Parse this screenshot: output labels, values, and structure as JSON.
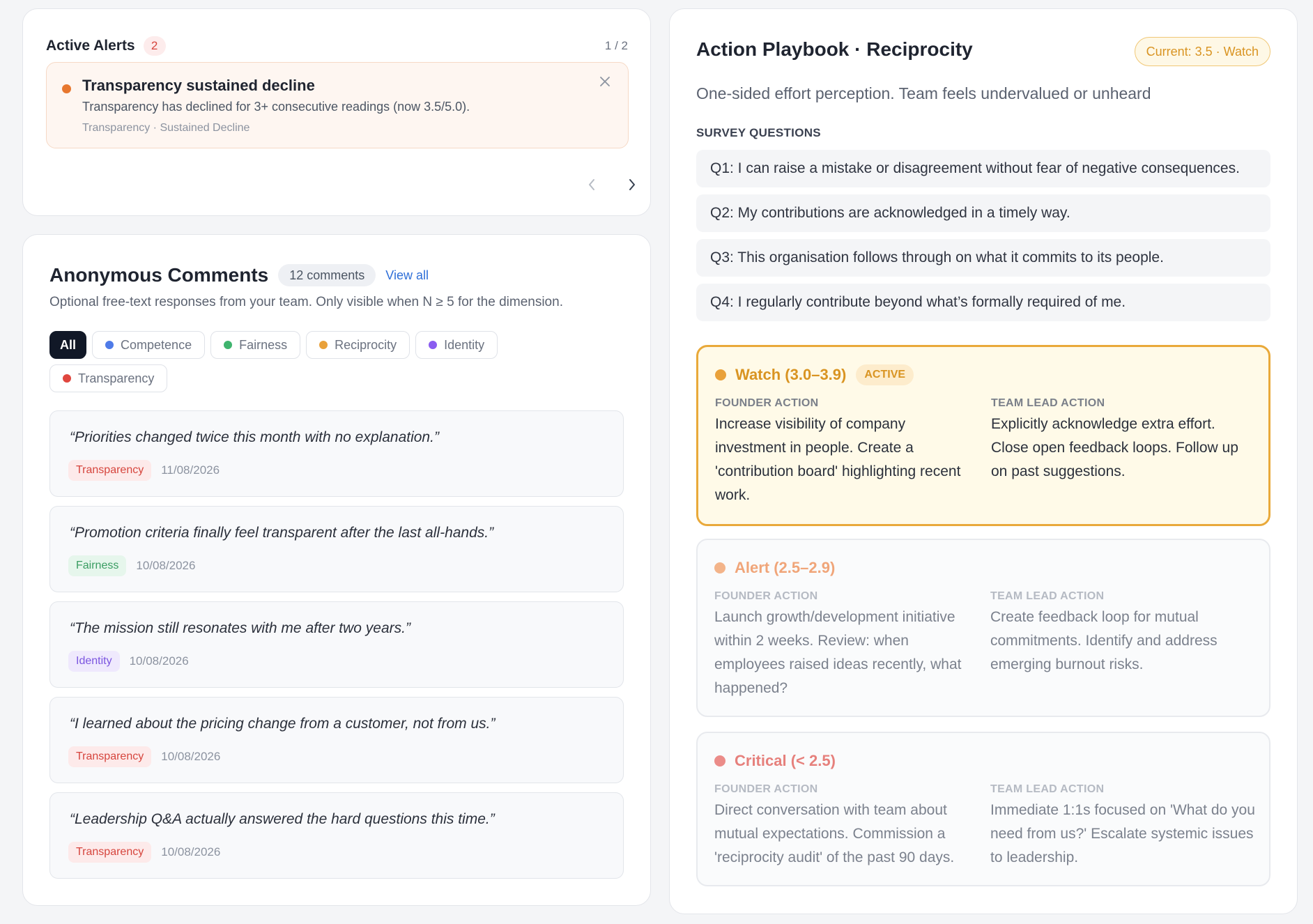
{
  "alerts": {
    "title": "Active Alerts",
    "count": "2",
    "pager": "1 / 2",
    "current": {
      "title": "Transparency sustained decline",
      "description": "Transparency has declined for 3+ consecutive readings (now 3.5/5.0).",
      "meta": "Transparency · Sustained Decline",
      "dot_color": "#e7772f"
    }
  },
  "comments": {
    "title": "Anonymous Comments",
    "count_label": "12 comments",
    "view_all": "View all",
    "subtitle": "Optional free-text responses from your team. Only visible when N ≥ 5 for the dimension.",
    "filters": [
      {
        "label": "All",
        "active": true
      },
      {
        "label": "Competence",
        "color": "#4f7be8"
      },
      {
        "label": "Fairness",
        "color": "#3fb46e"
      },
      {
        "label": "Reciprocity",
        "color": "#e9a13a"
      },
      {
        "label": "Identity",
        "color": "#8a5cf0"
      },
      {
        "label": "Transparency",
        "color": "#e0473f"
      }
    ],
    "items": [
      {
        "text": "“Priorities changed twice this month with no explanation.”",
        "tag": "Transparency",
        "date": "11/08/2026"
      },
      {
        "text": "“Promotion criteria finally feel transparent after the last all-hands.”",
        "tag": "Fairness",
        "date": "10/08/2026"
      },
      {
        "text": "“The mission still resonates with me after two years.”",
        "tag": "Identity",
        "date": "10/08/2026"
      },
      {
        "text": "“I learned about the pricing change from a customer, not from us.”",
        "tag": "Transparency",
        "date": "10/08/2026"
      },
      {
        "text": "“Leadership Q&A actually answered the hard questions this time.”",
        "tag": "Transparency",
        "date": "10/08/2026"
      }
    ],
    "tag_colors": {
      "Transparency": {
        "bg": "#fdeaea",
        "fg": "#d6453d"
      },
      "Fairness": {
        "bg": "#e6f6ec",
        "fg": "#3a9d62"
      },
      "Identity": {
        "bg": "#efe9fd",
        "fg": "#7b55e0"
      }
    }
  },
  "playbook": {
    "title": "Action Playbook · Reciprocity",
    "current": "Current: 3.5 · Watch",
    "subtitle": "One-sided effort perception. Team feels undervalued or unheard",
    "questions_label": "SURVEY QUESTIONS",
    "questions": [
      "Q1: I can raise a mistake or disagreement without fear of negative consequences.",
      "Q2: My contributions are acknowledged in a timely way.",
      "Q3: This organisation follows through on what it commits to its people.",
      "Q4: I regularly contribute beyond what’s formally required of me."
    ],
    "founder_label": "FOUNDER ACTION",
    "lead_label": "TEAM LEAD ACTION",
    "tiers": [
      {
        "name": "Watch (3.0–3.9)",
        "badge": "ACTIVE",
        "color": "#e9a13a",
        "name_color": "#d99422",
        "founder": "Increase visibility of company investment in people. Create a 'contribution board' highlighting recent work.",
        "lead": "Explicitly acknowledge extra effort. Close open feedback loops. Follow up on past suggestions."
      },
      {
        "name": "Alert (2.5–2.9)",
        "color": "#f3b48a",
        "name_color": "#f0a579",
        "founder": "Launch growth/development initiative within 2 weeks. Review: when employees raised ideas recently, what happened?",
        "lead": "Create feedback loop for mutual commitments. Identify and address emerging burnout risks."
      },
      {
        "name": "Critical (< 2.5)",
        "color": "#eb8c89",
        "name_color": "#e6807c",
        "founder": "Direct conversation with team about mutual expectations. Commission a 'reciprocity audit' of the past 90 days.",
        "lead": "Immediate 1:1s focused on 'What do you need from us?' Escalate systemic issues to leadership."
      }
    ]
  }
}
